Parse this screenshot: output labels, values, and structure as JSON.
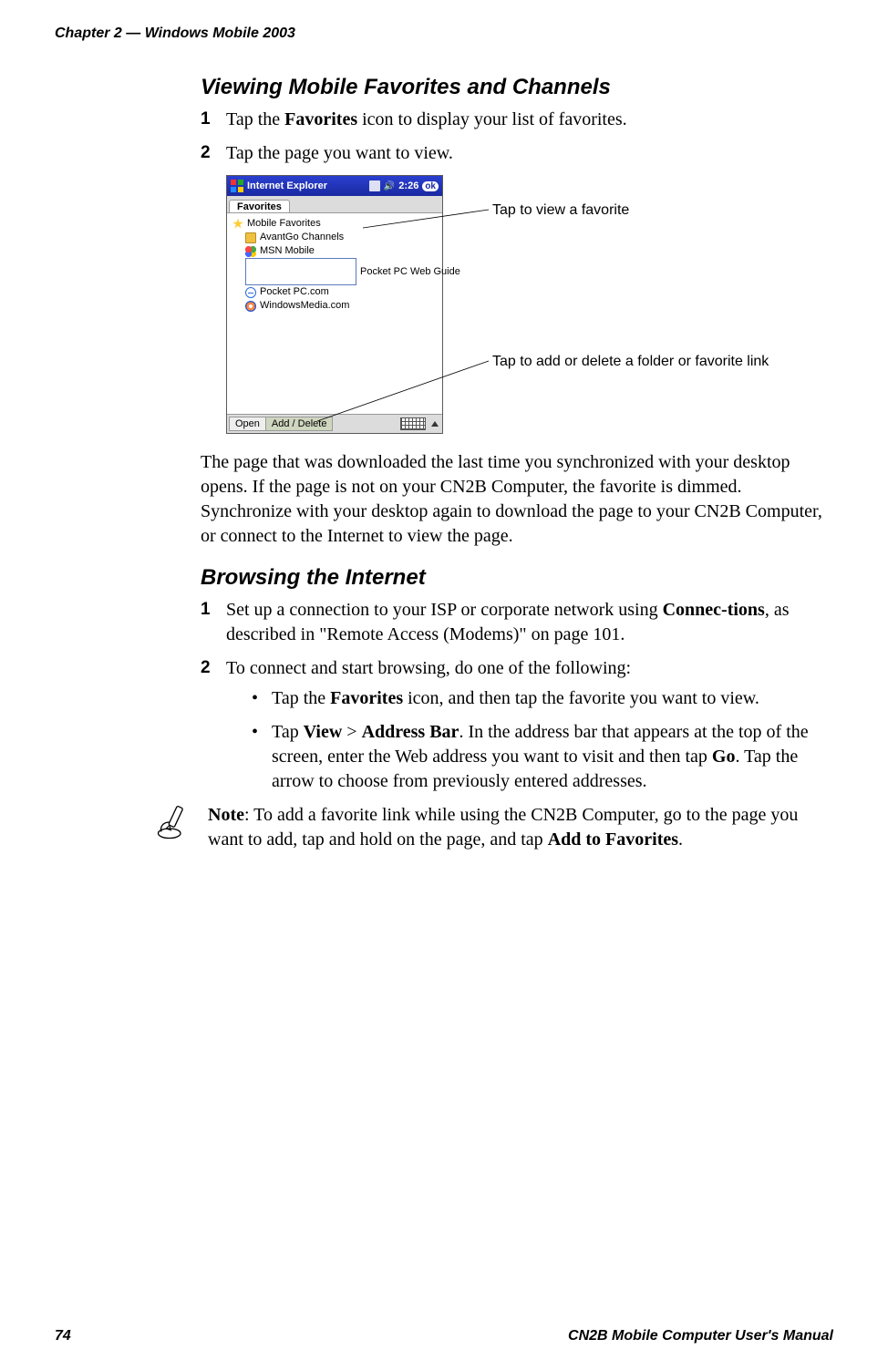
{
  "header": {
    "running": "Chapter 2 — Windows Mobile 2003"
  },
  "section1": {
    "title": "Viewing Mobile Favorites and Channels",
    "step1_pre": "Tap the ",
    "step1_bold": "Favorites",
    "step1_post": " icon to display your list of favorites.",
    "step2": "Tap the page you want to view.",
    "para": "The page that was downloaded the last time you synchronized with your desktop opens. If the page is not on your CN2B Computer, the favorite is dimmed. Synchronize with your desktop again to download the page to your CN2B Computer, or connect to the Internet to view the page."
  },
  "figure": {
    "title": "Internet Explorer",
    "clock": "2:26",
    "ok": "ok",
    "tab": "Favorites",
    "root": "Mobile Favorites",
    "items": [
      "AvantGo Channels",
      "MSN Mobile",
      "Pocket PC Web Guide",
      "Pocket PC.com",
      "WindowsMedia.com"
    ],
    "btn_open": "Open",
    "btn_add": "Add / Delete",
    "callout1": "Tap to view a favorite",
    "callout2": "Tap to add or delete a folder or favorite link"
  },
  "section2": {
    "title": "Browsing the Internet",
    "step1_pre": "Set up a connection to your ISP or corporate network using ",
    "step1_bold": "Connec-tions",
    "step1_post": ", as described in \"Remote Access (Modems)\" on page 101.",
    "step2": "To connect and start browsing, do one of the following:",
    "bullet1_pre": "Tap the ",
    "bullet1_bold": "Favorites",
    "bullet1_post": " icon, and then tap the favorite you want to view.",
    "bullet2_a": "Tap ",
    "bullet2_b": "View",
    "bullet2_c": " > ",
    "bullet2_d": "Address Bar",
    "bullet2_e": ". In the address bar that appears at the top of the screen, enter the Web address you want to visit and then tap ",
    "bullet2_f": "Go",
    "bullet2_g": ". Tap the arrow to choose from previously entered addresses."
  },
  "note": {
    "a": "Note",
    "b": ": To add a favorite link while using the CN2B Computer, go to the page you want to add, tap and hold on the page, and tap ",
    "c": "Add to Favorites",
    "d": "."
  },
  "footer": {
    "page": "74",
    "title": "CN2B Mobile Computer User's Manual"
  }
}
